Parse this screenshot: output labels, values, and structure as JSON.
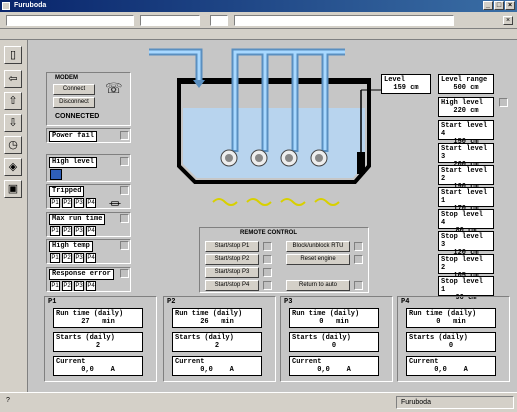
{
  "window": {
    "title": "Furuboda",
    "min": "_",
    "max": "□",
    "close": "×"
  },
  "menubar": {
    "field1": "",
    "field2": "",
    "field3": "",
    "field4": "",
    "close_x": "×"
  },
  "modem": {
    "title": "MODEM",
    "connect": "Connect",
    "disconnect": "Disconnect",
    "status": "CONNECTED"
  },
  "left_alarms": {
    "power_fail": "Power fail",
    "high_level": "High level",
    "tripped": "Tripped",
    "max_run_time": "Max run time",
    "high_temp": "High temp",
    "response_error": "Response error",
    "pumps": [
      "P1",
      "P2",
      "P3",
      "P4"
    ]
  },
  "level": {
    "label": "Level",
    "value": "159",
    "unit": "cm"
  },
  "right_levels": [
    {
      "label": "Level range",
      "value": "500",
      "unit": "cm"
    },
    {
      "label": "High level",
      "value": "220",
      "unit": "cm"
    },
    {
      "label": "Start level 4",
      "value": "150",
      "unit": "cm"
    },
    {
      "label": "Start level 3",
      "value": "200",
      "unit": "cm"
    },
    {
      "label": "Start level 2",
      "value": "190",
      "unit": "cm"
    },
    {
      "label": "Start level 1",
      "value": "170",
      "unit": "cm"
    },
    {
      "label": "Stop level 4",
      "value": "80",
      "unit": "cm"
    },
    {
      "label": "Stop level 3",
      "value": "120",
      "unit": "cm"
    },
    {
      "label": "Stop level 2",
      "value": "105",
      "unit": "cm"
    },
    {
      "label": "Stop level 1",
      "value": "90",
      "unit": "cm"
    }
  ],
  "remote": {
    "title": "REMOTE CONTROL",
    "start_stop": [
      "Start/stop P1",
      "Start/stop P2",
      "Start/stop P3",
      "Start/stop P4"
    ],
    "block_rtu": "Block/unblock RTU",
    "reset_engine": "Reset engine",
    "return_auto": "Return to auto"
  },
  "pumps": [
    {
      "name": "P1",
      "run_label": "Run time (daily)",
      "run": "27",
      "run_unit": "min",
      "starts_label": "Starts (daily)",
      "starts": "2",
      "current_label": "Current",
      "current": "0,0",
      "current_unit": "A"
    },
    {
      "name": "P2",
      "run_label": "Run time (daily)",
      "run": "26",
      "run_unit": "min",
      "starts_label": "Starts (daily)",
      "starts": "2",
      "current_label": "Current",
      "current": "0,0",
      "current_unit": "A"
    },
    {
      "name": "P3",
      "run_label": "Run time (daily)",
      "run": "0",
      "run_unit": "min",
      "starts_label": "Starts (daily)",
      "starts": "0",
      "current_label": "Current",
      "current": "0,0",
      "current_unit": "A"
    },
    {
      "name": "P4",
      "run_label": "Run time (daily)",
      "run": "0",
      "run_unit": "min",
      "starts_label": "Starts (daily)",
      "starts": "0",
      "current_label": "Current",
      "current": "0,0",
      "current_unit": "A"
    }
  ],
  "statusbar": {
    "left": "?",
    "right": "Furuboda"
  },
  "colors": {
    "pipe": "#8fc8f0",
    "water": "#b8d4ee",
    "tank_border": "#000000",
    "wave": "#d8d000"
  }
}
